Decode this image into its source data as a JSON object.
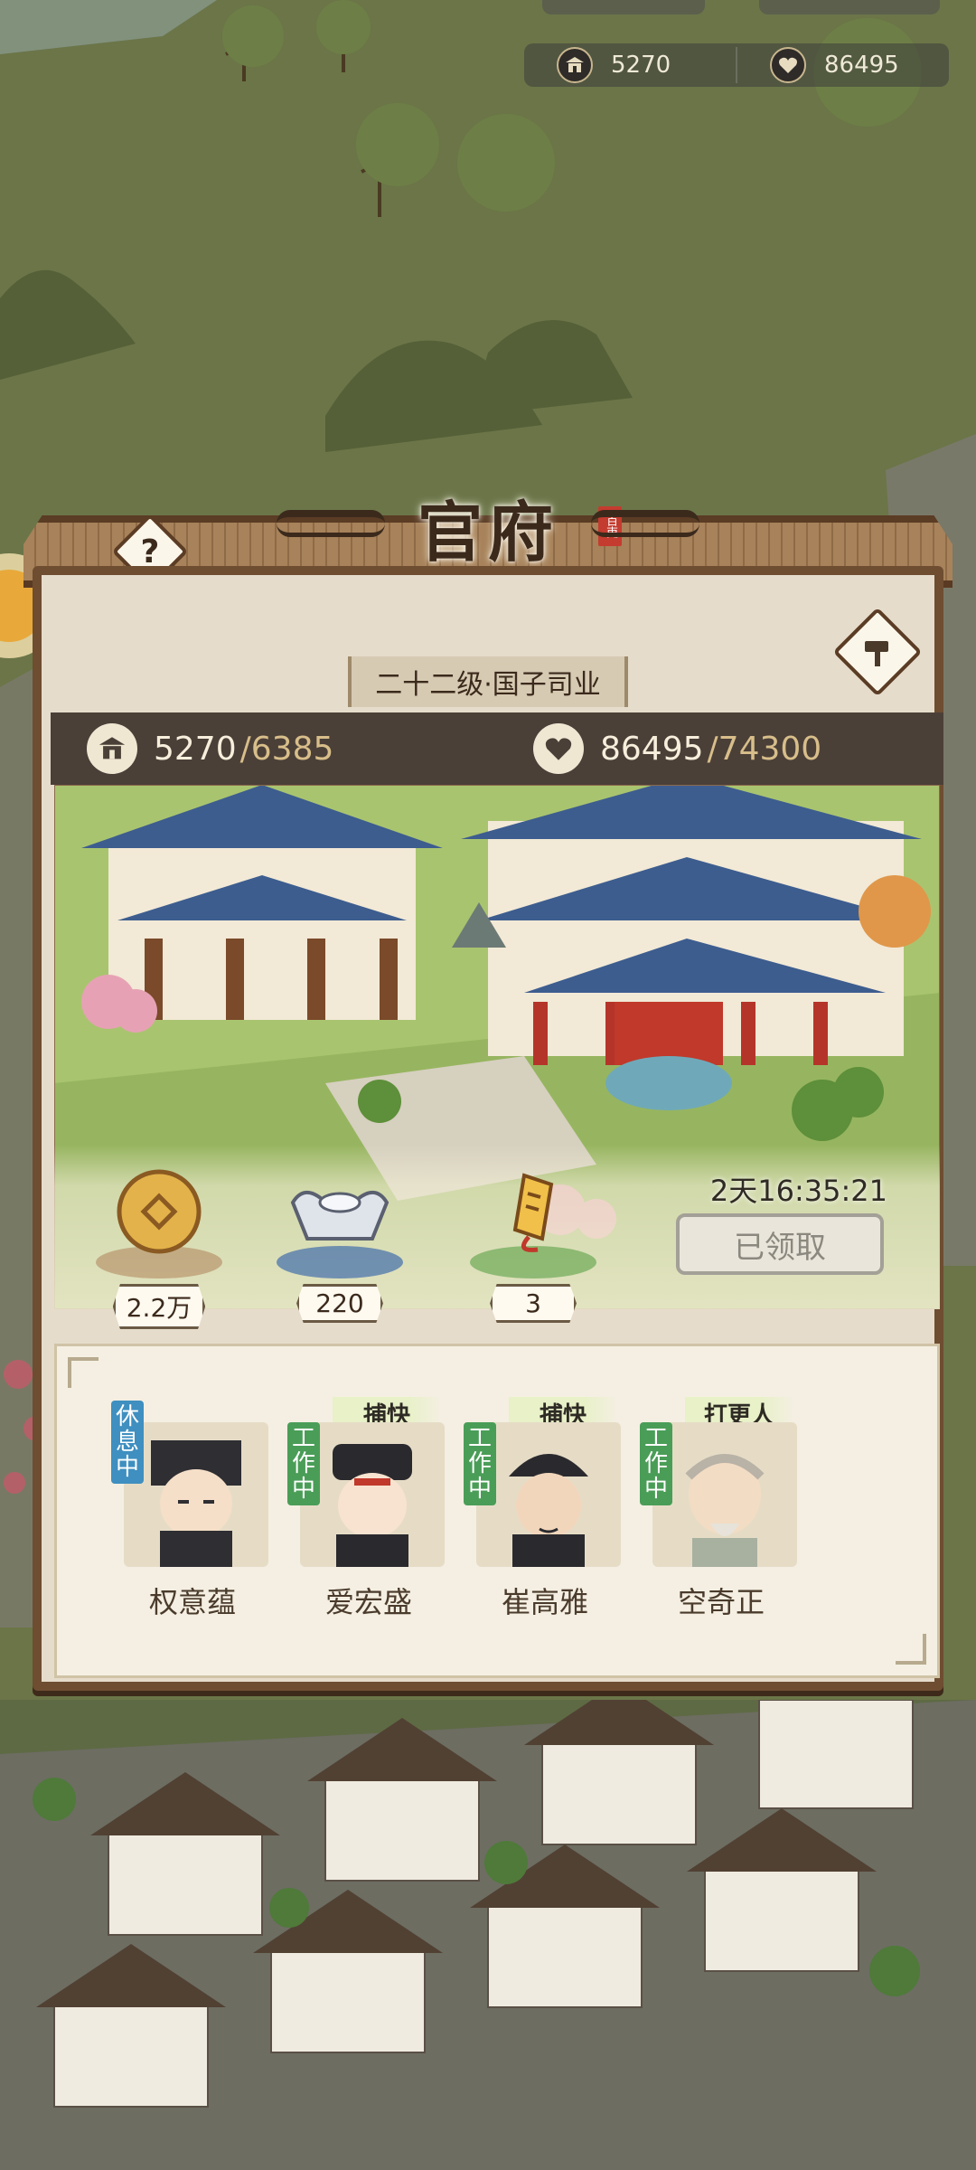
{
  "top_resources": [
    {
      "icon": "gate-icon",
      "value": "5270"
    },
    {
      "icon": "heart-icon",
      "value": "86495"
    }
  ],
  "panel": {
    "title": "官府",
    "title_stamp": "百吏",
    "level_label": "二十二级·国子司业",
    "stats": {
      "gate": {
        "icon": "gate-icon",
        "value": "5270",
        "max": "/6385"
      },
      "heart": {
        "icon": "heart-icon",
        "value": "86495",
        "max": "/74300"
      }
    },
    "rewards": [
      {
        "icon": "copper-coin-icon",
        "count": "2.2万"
      },
      {
        "icon": "silver-ingot-icon",
        "count": "220"
      },
      {
        "icon": "golden-token-icon",
        "count": "3"
      }
    ],
    "timer": "2天16:35:21",
    "claim_button": "已领取"
  },
  "staff": [
    {
      "name": "权意蕴",
      "status": "休息中",
      "role": ""
    },
    {
      "name": "爱宏盛",
      "status": "工作中",
      "role": "捕快"
    },
    {
      "name": "崔高雅",
      "status": "工作中",
      "role": "捕快"
    },
    {
      "name": "空奇正",
      "status": "工作中",
      "role": "打更人"
    }
  ],
  "colors": {
    "frame": "#6e4d31",
    "rest_tag": "#3f8fc0",
    "work_tag": "#4a9d57",
    "stats_bar": "#4b4038",
    "accent_gold": "#d8be8a"
  }
}
